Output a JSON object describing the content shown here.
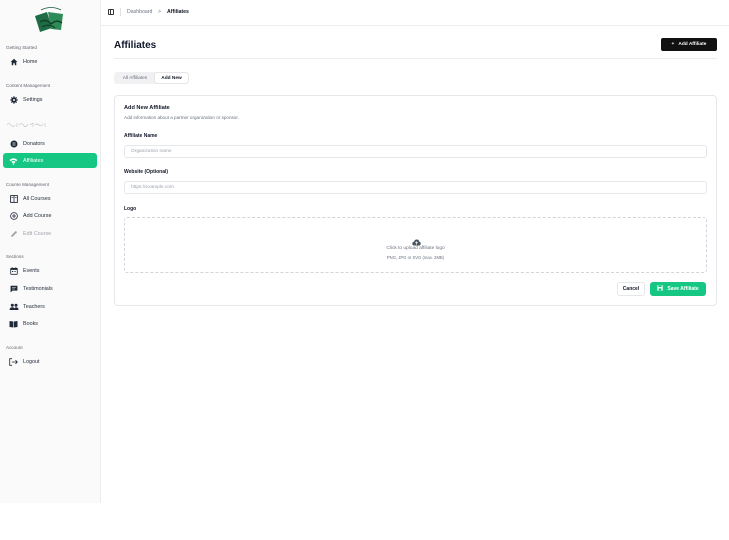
{
  "sidebar": {
    "groups": {
      "getting_started": "Getting Started",
      "content_management": "Content Management",
      "course_management": "Course Management",
      "sections": "Sections",
      "account": "Account"
    },
    "items": {
      "home": "Home",
      "settings": "Settings",
      "donators": "Donators",
      "affiliates": "Affiliates",
      "all_courses": "All Courses",
      "add_course": "Add Course",
      "edit_course": "Edit Course",
      "events": "Events",
      "testimonials": "Testimonials",
      "teachers": "Teachers",
      "books": "Books",
      "logout": "Logout"
    },
    "active_color": "#16c784"
  },
  "breadcrumb": {
    "root": "Dashboard",
    "sep": ">",
    "current": "Affiliates"
  },
  "page": {
    "title": "Affiliates",
    "add_button": "Add Affiliate",
    "add_icon": "+"
  },
  "tabs": {
    "all": "All Affiliates",
    "add": "Add New"
  },
  "form": {
    "title": "Add New Affiliate",
    "subtitle": "Add information about a partner organization or sponsor.",
    "name_label": "Affiliate Name",
    "name_placeholder": "Organization name",
    "website_label": "Website (Optional)",
    "website_placeholder": "https://example.com",
    "logo_label": "Logo",
    "upload_text": "Click to upload affiliate logo",
    "upload_hint": "PNG, JPG or SVG (max. 2MB)",
    "cancel": "Cancel",
    "save": "Save Affiliate"
  }
}
